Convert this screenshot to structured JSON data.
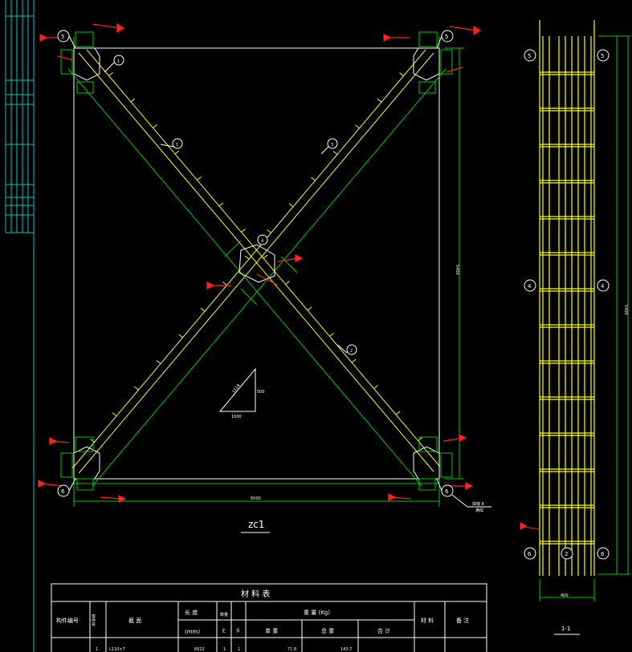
{
  "colors": {
    "background": "#000000",
    "line_white": "#ffffff",
    "member_yellow": "#ffff00",
    "dimension_green": "#00c800",
    "section_red": "#ff2020",
    "border_cyan": "#00c8c8"
  },
  "main_view": {
    "title": "zc1",
    "width_dim": "6000",
    "height_dim": "5400",
    "balloons": {
      "b1": "1",
      "b2": "2",
      "b3": "3",
      "b4": "4",
      "b5": "5",
      "b6": "6"
    },
    "slope": {
      "rise": "500",
      "run": "1000",
      "hyp": "1118"
    },
    "note_line1": "焊缝 8",
    "note_line2": "满焊"
  },
  "section_view": {
    "title": "1-1",
    "width_dim": "400",
    "height_dim": "5400",
    "balloons": {
      "top_left": "5",
      "top_right": "5",
      "mid_left": "4",
      "mid_right": "4",
      "bot_left": "6",
      "bot_mid": "2",
      "bot_right": "6"
    }
  },
  "table": {
    "title": "材 料 表",
    "headers": {
      "component_no": "构件编号",
      "part_no": "零件号",
      "section": "截 面",
      "length": "长 度",
      "length_unit": "(mm)",
      "quantity": "数量",
      "qty_pos": "正",
      "qty_neg": "反",
      "weight": "重 量 (Kg)",
      "unit_weight": "单 重",
      "total_weight": "总 重",
      "sum": "合 计",
      "material": "材 料",
      "remarks": "备 注"
    },
    "rows": [
      {
        "part": "1",
        "section": "L110×7",
        "length": "6022",
        "pos": "1",
        "neg": "1",
        "unit": "71.8",
        "total": "143.7",
        "sum": ""
      }
    ]
  }
}
